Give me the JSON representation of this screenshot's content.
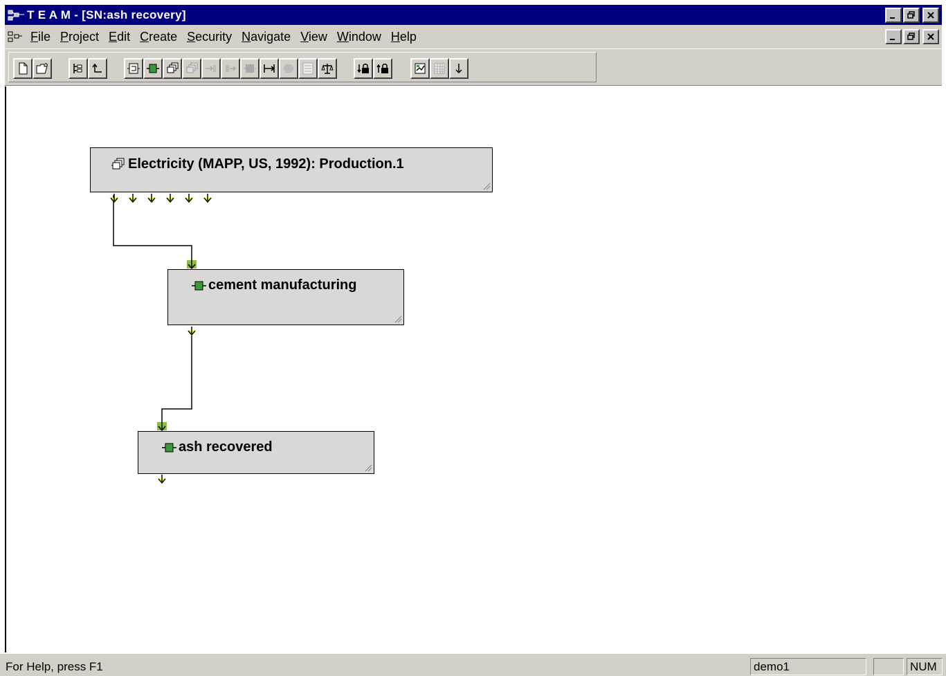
{
  "window": {
    "title": "T E A M - [SN:ash recovery]",
    "minimize": "_",
    "restore": "▫",
    "close": "✕"
  },
  "menu": {
    "items": [
      {
        "label": "File",
        "ul": "F"
      },
      {
        "label": "Project",
        "ul": "P"
      },
      {
        "label": "Edit",
        "ul": "E"
      },
      {
        "label": "Create",
        "ul": "C"
      },
      {
        "label": "Security",
        "ul": "S"
      },
      {
        "label": "Navigate",
        "ul": "N"
      },
      {
        "label": "View",
        "ul": "V"
      },
      {
        "label": "Window",
        "ul": "W"
      },
      {
        "label": "Help",
        "ul": "H"
      }
    ]
  },
  "toolbar": {
    "buttons": [
      {
        "name": "new-document-icon",
        "enabled": true
      },
      {
        "name": "open-folder-icon",
        "enabled": true
      },
      {
        "name": "tree-view-icon",
        "enabled": true
      },
      {
        "name": "go-up-icon",
        "enabled": true
      },
      {
        "name": "system-node-icon",
        "enabled": true
      },
      {
        "name": "process-module-icon",
        "enabled": true
      },
      {
        "name": "stacked-module-icon",
        "enabled": true
      },
      {
        "name": "stacked-module-disabled-icon",
        "enabled": false
      },
      {
        "name": "input-arrow-icon",
        "enabled": false
      },
      {
        "name": "output-arrow-icon",
        "enabled": false
      },
      {
        "name": "block-icon",
        "enabled": false
      },
      {
        "name": "connect-flow-icon",
        "enabled": true
      },
      {
        "name": "hexagon-icon",
        "enabled": false
      },
      {
        "name": "data-sheet-icon",
        "enabled": false
      },
      {
        "name": "balance-scale-icon",
        "enabled": true
      },
      {
        "name": "lock-down-icon",
        "enabled": true
      },
      {
        "name": "lock-up-icon",
        "enabled": true
      },
      {
        "name": "report-icon",
        "enabled": true
      },
      {
        "name": "grid-table-icon",
        "enabled": false
      },
      {
        "name": "arrow-down-icon",
        "enabled": true
      }
    ]
  },
  "diagram": {
    "nodes": [
      {
        "id": "electricity",
        "label": "Electricity (MAPP, US, 1992): Production.1",
        "type": "stacked-module"
      },
      {
        "id": "cement",
        "label": "cement manufacturing",
        "type": "module"
      },
      {
        "id": "ash",
        "label": "ash recovered",
        "type": "module"
      }
    ],
    "edges": [
      {
        "from": "electricity",
        "to": "cement"
      },
      {
        "from": "cement",
        "to": "ash"
      }
    ],
    "colors": {
      "flow_arrow": "#ffff00",
      "module": "#3a9a3a",
      "box": "#d9d8d6"
    }
  },
  "status": {
    "help_text": "For Help, press F1",
    "user": "demo1",
    "empty_pane": "",
    "num_lock": "NUM"
  }
}
